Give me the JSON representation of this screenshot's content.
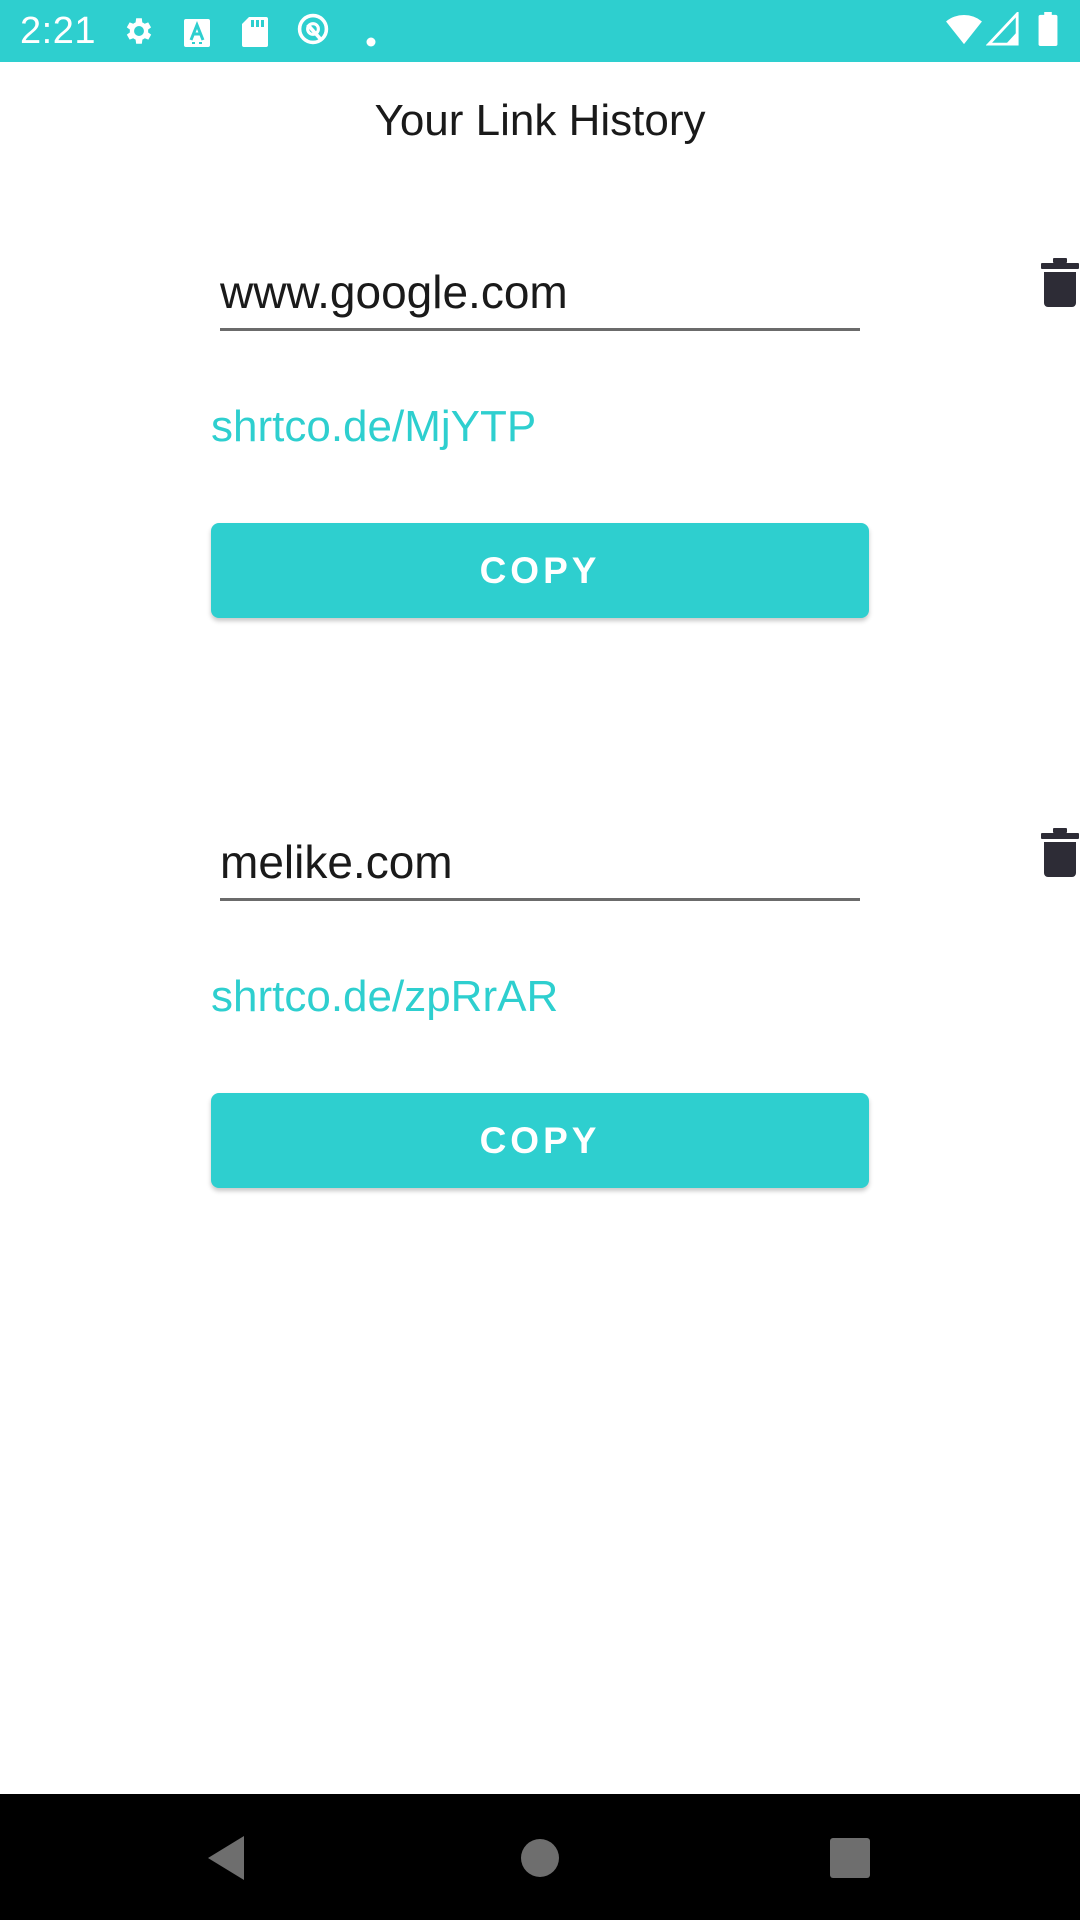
{
  "status_bar": {
    "time": "2:21",
    "background_color": "#2ecfcf",
    "left_icons": [
      "settings-icon",
      "font-a-icon",
      "sd-card-icon",
      "vpn-q-icon",
      "dot-icon"
    ],
    "right_icons": [
      "wifi-icon",
      "cell-signal-icon",
      "battery-icon"
    ]
  },
  "page": {
    "title": "Your Link History"
  },
  "history": [
    {
      "original_url": "www.google.com",
      "short_link": "shrtco.de/MjYTP",
      "copy_label": "COPY"
    },
    {
      "original_url": "melike.com",
      "short_link": "shrtco.de/zpRrAR",
      "copy_label": "COPY"
    }
  ],
  "colors": {
    "accent": "#2ecfcf",
    "text": "#1a1a1a",
    "icon": "#2d2c36",
    "nav_bar": "#000000"
  },
  "nav_bar": {
    "buttons": [
      "back-triangle-icon",
      "home-circle-icon",
      "recents-square-icon"
    ]
  }
}
